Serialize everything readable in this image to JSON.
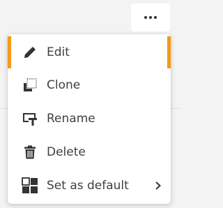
{
  "more_button": {
    "icon": "more-horizontal-icon"
  },
  "menu": {
    "items": [
      {
        "label": "Edit",
        "icon": "pencil-icon",
        "active": true
      },
      {
        "label": "Clone",
        "icon": "clone-icon"
      },
      {
        "label": "Rename",
        "icon": "rename-icon"
      },
      {
        "label": "Delete",
        "icon": "trash-icon"
      },
      {
        "label": "Set as default",
        "icon": "grid-default-icon",
        "submenu_icon": "chevron-right-icon"
      }
    ]
  },
  "colors": {
    "accent": "#f39a1e",
    "text": "#404040",
    "background": "#f3f3f3"
  }
}
